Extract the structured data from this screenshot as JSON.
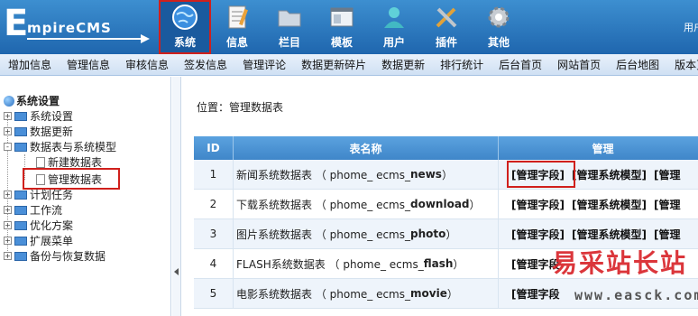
{
  "logo": {
    "letter": "E",
    "text": "mpireCMS"
  },
  "topnav": [
    {
      "label": "系统",
      "icon": "globe-icon",
      "active": true
    },
    {
      "label": "信息",
      "icon": "notepad-icon",
      "active": false
    },
    {
      "label": "栏目",
      "icon": "folder-icon",
      "active": false
    },
    {
      "label": "模板",
      "icon": "window-icon",
      "active": false
    },
    {
      "label": "用户",
      "icon": "user-icon",
      "active": false
    },
    {
      "label": "插件",
      "icon": "tools-icon",
      "active": false
    },
    {
      "label": "其他",
      "icon": "gear-icon",
      "active": false
    }
  ],
  "user_text": "用户",
  "subnav": [
    "增加信息",
    "管理信息",
    "审核信息",
    "签发信息",
    "管理评论",
    "数据更新碎片",
    "数据更新",
    "排行统计",
    "后台首页",
    "网站首页",
    "后台地图",
    "版本更新"
  ],
  "sidebar": {
    "title": "系统设置",
    "items": [
      {
        "label": "系统设置",
        "type": "folder",
        "pm": "+"
      },
      {
        "label": "数据更新",
        "type": "folder",
        "pm": "+"
      },
      {
        "label": "数据表与系统模型",
        "type": "folder",
        "pm": "-"
      },
      {
        "label": "新建数据表",
        "type": "doc",
        "pm": ""
      },
      {
        "label": "管理数据表",
        "type": "doc",
        "pm": ""
      },
      {
        "label": "计划任务",
        "type": "folder",
        "pm": "+"
      },
      {
        "label": "工作流",
        "type": "folder",
        "pm": "+"
      },
      {
        "label": "优化方案",
        "type": "folder",
        "pm": "+"
      },
      {
        "label": "扩展菜单",
        "type": "folder",
        "pm": "+"
      },
      {
        "label": "备份与恢复数据",
        "type": "folder",
        "pm": "+"
      }
    ]
  },
  "location": {
    "prefix": "位置：",
    "current": "管理数据表"
  },
  "table": {
    "headers": [
      "ID",
      "表名称",
      "管理"
    ],
    "rows": [
      {
        "id": "1",
        "name": "新闻系统数据表 （ phome_ ecms_ ",
        "table": "news",
        "suffix": " ）",
        "ops": [
          "[管理字段]",
          "[管理系统模型]",
          "[管理"
        ]
      },
      {
        "id": "2",
        "name": "下载系统数据表 （ phome_ ecms_ ",
        "table": "download",
        "suffix": " ）",
        "ops": [
          "[管理字段]",
          "[管理系统模型]",
          "[管理"
        ]
      },
      {
        "id": "3",
        "name": "图片系统数据表 （ phome_ ecms_ ",
        "table": "photo",
        "suffix": " ）",
        "ops": [
          "[管理字段]",
          "[管理系统模型]",
          "[管理"
        ]
      },
      {
        "id": "4",
        "name": "FLASH系统数据表 （ phome_ ecms_ ",
        "table": "flash",
        "suffix": " ）",
        "ops": [
          "[管理字段",
          "",
          ""
        ]
      },
      {
        "id": "5",
        "name": "电影系统数据表 （ phome_ ecms_ ",
        "table": "movie",
        "suffix": " ）",
        "ops": [
          "[管理字段",
          "",
          ""
        ]
      }
    ]
  },
  "watermark": {
    "cn": "易采站长站",
    "url": "www.easck.com"
  }
}
